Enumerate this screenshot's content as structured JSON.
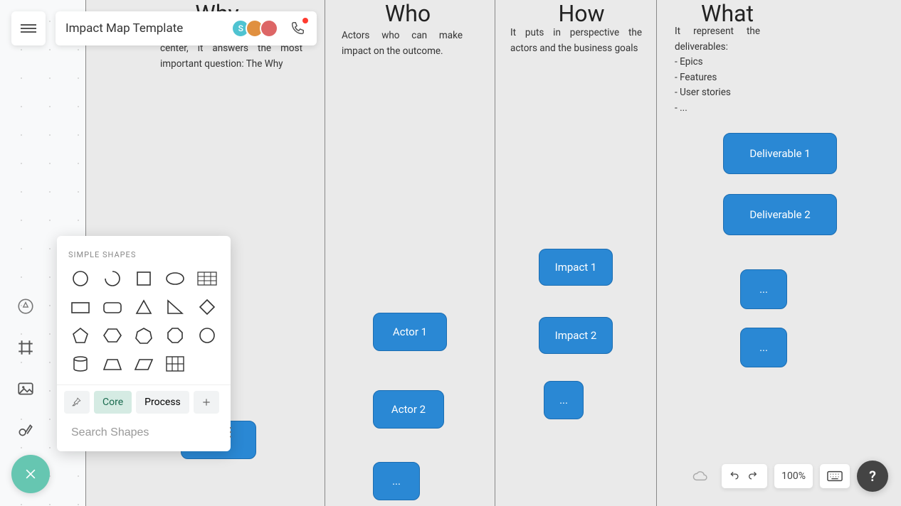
{
  "header": {
    "doc_title": "Impact Map Template"
  },
  "avatars": {
    "a1_initial": "S"
  },
  "columns": {
    "why": {
      "title": "Why",
      "desc": "center, it answers the most important question: The Why"
    },
    "who": {
      "title": "Who",
      "desc": "Actors who can make impact on the outcome."
    },
    "how": {
      "title": "How",
      "desc": "It puts in perspective the actors and the business goals"
    },
    "what": {
      "title": "What",
      "desc": "It represent the deliverables:\n- Epics\n- Features\n- User stories\n- ..."
    }
  },
  "shapes_panel": {
    "heading": "SIMPLE SHAPES",
    "tab_core": "Core",
    "tab_process": "Process",
    "search_placeholder": "Search Shapes"
  },
  "nodes": {
    "root": "",
    "actor1": "Actor 1",
    "actor2": "Actor 2",
    "actor3": "...",
    "impact1": "Impact 1",
    "impact2": "Impact 2",
    "impact3": "...",
    "deliv1": "Deliverable 1",
    "deliv2": "Deliverable 2",
    "deliv3": "...",
    "deliv4": "..."
  },
  "footer": {
    "zoom": "100%"
  },
  "help": {
    "label": "?"
  }
}
